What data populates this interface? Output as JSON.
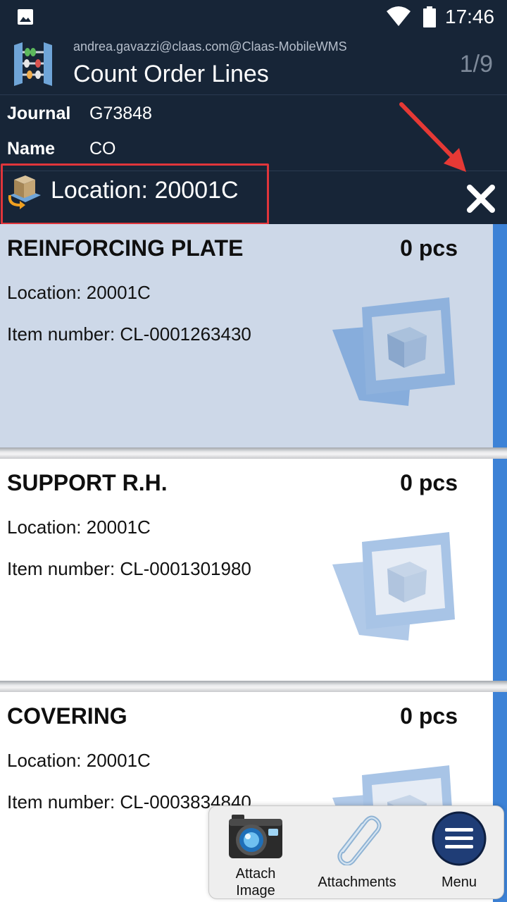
{
  "status_bar": {
    "time": "17:46",
    "icons": [
      "gallery-icon",
      "wifi-icon",
      "battery-icon"
    ]
  },
  "header": {
    "user": "andrea.gavazzi@claas.com@Claas-MobileWMS",
    "title": "Count Order Lines",
    "page_counter": "1/9",
    "icon": "abacus-icon"
  },
  "journal_info": [
    {
      "label": "Journal",
      "value": "G73848"
    },
    {
      "label": "Name",
      "value": "CO"
    }
  ],
  "filter": {
    "label": "Location: 20001C",
    "icon": "location-box-icon",
    "close_icon": "close-icon"
  },
  "items": [
    {
      "title": "REINFORCING PLATE",
      "qty": "0 pcs",
      "location": "Location: 20001C",
      "item_number": "Item number: CL-0001263430",
      "selected": true
    },
    {
      "title": "SUPPORT R.H.",
      "qty": "0 pcs",
      "location": "Location: 20001C",
      "item_number": "Item number: CL-0001301980",
      "selected": false
    },
    {
      "title": "COVERING",
      "qty": "0 pcs",
      "location": "Location: 20001C",
      "item_number": "Item number: CL-0003834840",
      "selected": false
    }
  ],
  "actions": {
    "attach_image": {
      "line1": "Attach",
      "line2": "Image",
      "icon": "camera-icon"
    },
    "attachments": {
      "label": "Attachments",
      "icon": "paperclip-icon"
    },
    "menu": {
      "label": "Menu",
      "icon": "hamburger-menu-icon"
    }
  },
  "colors": {
    "header_bg": "#172537",
    "accent": "#3d82d6",
    "selected_bg": "#cdd8e8",
    "highlight_red": "#e0353b"
  }
}
